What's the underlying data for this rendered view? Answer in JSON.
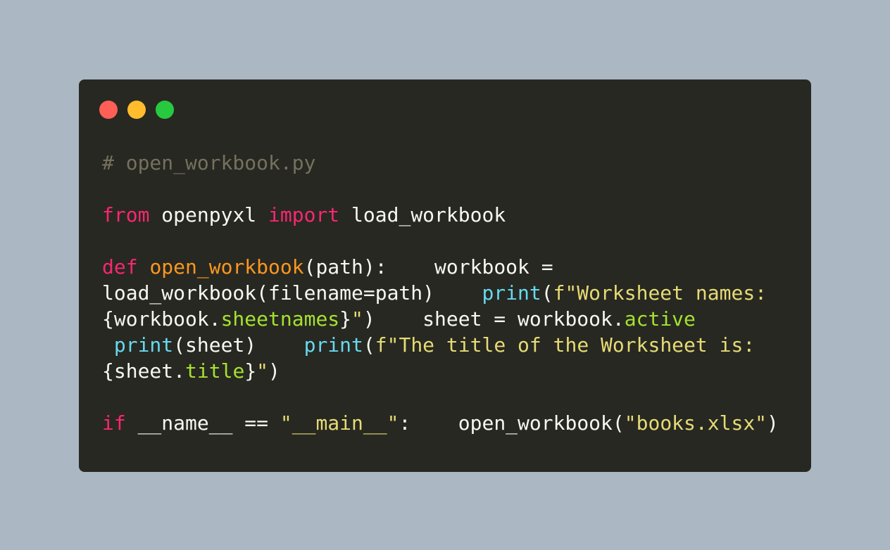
{
  "window": {
    "controls": [
      {
        "name": "close-dot",
        "color": "#ff5f56"
      },
      {
        "name": "minimize-dot",
        "color": "#ffbd2e"
      },
      {
        "name": "zoom-dot",
        "color": "#27c93f"
      }
    ]
  },
  "code": {
    "lines": [
      [
        {
          "t": "# open_workbook.py",
          "k": "com"
        }
      ],
      [],
      [
        {
          "t": "from",
          "k": "kw"
        },
        {
          "t": " openpyxl ",
          "k": "plain"
        },
        {
          "t": "import",
          "k": "kw"
        },
        {
          "t": " load_workbook",
          "k": "plain"
        }
      ],
      [],
      [
        {
          "t": "def",
          "k": "kw"
        },
        {
          "t": " ",
          "k": "plain"
        },
        {
          "t": "open_workbook",
          "k": "fn"
        },
        {
          "t": "(path):    workbook =",
          "k": "plain"
        }
      ],
      [
        {
          "t": "load_workbook(filename=path)    ",
          "k": "plain"
        },
        {
          "t": "print",
          "k": "bi"
        },
        {
          "t": "(",
          "k": "plain"
        },
        {
          "t": "f\"Worksheet names:",
          "k": "str"
        }
      ],
      [
        {
          "t": "{workbook.",
          "k": "plain"
        },
        {
          "t": "sheetnames",
          "k": "attr"
        },
        {
          "t": "}",
          "k": "plain"
        },
        {
          "t": "\"",
          "k": "str"
        },
        {
          "t": ")    sheet = workbook.",
          "k": "plain"
        },
        {
          "t": "active",
          "k": "attr"
        }
      ],
      [
        {
          "t": " ",
          "k": "plain"
        },
        {
          "t": "print",
          "k": "bi"
        },
        {
          "t": "(sheet)    ",
          "k": "plain"
        },
        {
          "t": "print",
          "k": "bi"
        },
        {
          "t": "(",
          "k": "plain"
        },
        {
          "t": "f\"The title of the Worksheet is:",
          "k": "str"
        }
      ],
      [
        {
          "t": "{sheet.",
          "k": "plain"
        },
        {
          "t": "title",
          "k": "attr"
        },
        {
          "t": "}",
          "k": "plain"
        },
        {
          "t": "\"",
          "k": "str"
        },
        {
          "t": ")",
          "k": "plain"
        }
      ],
      [],
      [
        {
          "t": "if",
          "k": "kw"
        },
        {
          "t": " __name__ == ",
          "k": "plain"
        },
        {
          "t": "\"__main__\"",
          "k": "str"
        },
        {
          "t": ":    open_workbook(",
          "k": "plain"
        },
        {
          "t": "\"books.xlsx\"",
          "k": "str"
        },
        {
          "t": ")",
          "k": "plain"
        }
      ]
    ]
  }
}
